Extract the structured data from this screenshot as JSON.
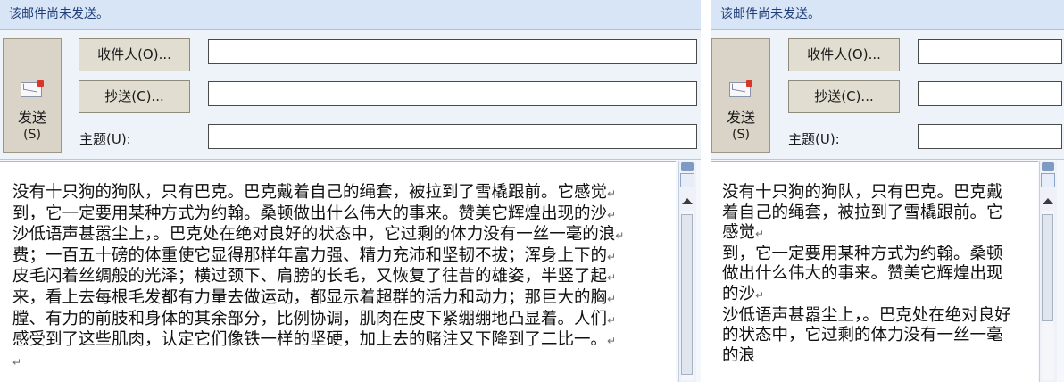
{
  "left": {
    "info_bar": "该邮件尚未发送。",
    "send_button": {
      "label": "发送",
      "shortcut": "(S)"
    },
    "to_button": "收件人(O)...",
    "cc_button": "抄送(C)...",
    "subject_label": "主题(U):",
    "to_value": "",
    "cc_value": "",
    "subject_value": "",
    "body_lines": [
      "没有十只狗的狗队，只有巴克。巴克戴着自己的绳套，被拉到了雪橇跟前。它感觉",
      "到，它一定要用某种方式为约翰。桑顿做出什么伟大的事来。赞美它辉煌出现的沙",
      "沙低语声甚嚣尘上，。巴克处在绝对良好的状态中，它过剩的体力没有一丝一毫的浪",
      "费；一百五十磅的体重使它显得那样年富力强、精力充沛和坚韧不拔；浑身上下的",
      "皮毛闪着丝绸般的光泽；横过颈下、肩膀的长毛，又恢复了往昔的雄姿，半竖了起",
      "来，看上去每根毛发都有力量去做运动，都显示着超群的活力和动力；那巨大的胸",
      "膛、有力的前肢和身体的其余部分，比例协调，肌肉在皮下紧绷绷地凸显着。人们",
      "感受到了这些肌肉，认定它们像铁一样的坚硬，加上去的赌注又下降到了二比一。",
      ""
    ],
    "paragraph_mark": "↵"
  },
  "right": {
    "info_bar": "该邮件尚未发送。",
    "send_button": {
      "label": "发送",
      "shortcut": "(S)"
    },
    "to_button": "收件人(O)...",
    "cc_button": "抄送(C)...",
    "subject_label": "主题(U):",
    "to_value": "",
    "cc_value": "",
    "subject_value": "",
    "body_lines": [
      "没有十只狗的狗队，只有巴克。巴克戴",
      "着自己的绳套，被拉到了雪橇跟前。它",
      "感觉",
      "到，它一定要用某种方式为约翰。桑顿",
      "做出什么伟大的事来。赞美它辉煌出现",
      "的沙",
      "沙低语声甚嚣尘上，。巴克处在绝对良好",
      "的状态中，它过剩的体力没有一丝一毫",
      "的浪"
    ],
    "paragraph_mark": "↵"
  },
  "colors": {
    "info_bar_bg": "#d7e5f6",
    "info_bar_text": "#1f3e78",
    "header_bg": "#eef3fa",
    "button_face": "#e2ddd1"
  },
  "icons": [
    "envelope-send-icon",
    "scroll-up-arrow-icon",
    "split-handle-icon",
    "view-ruler-icon"
  ]
}
